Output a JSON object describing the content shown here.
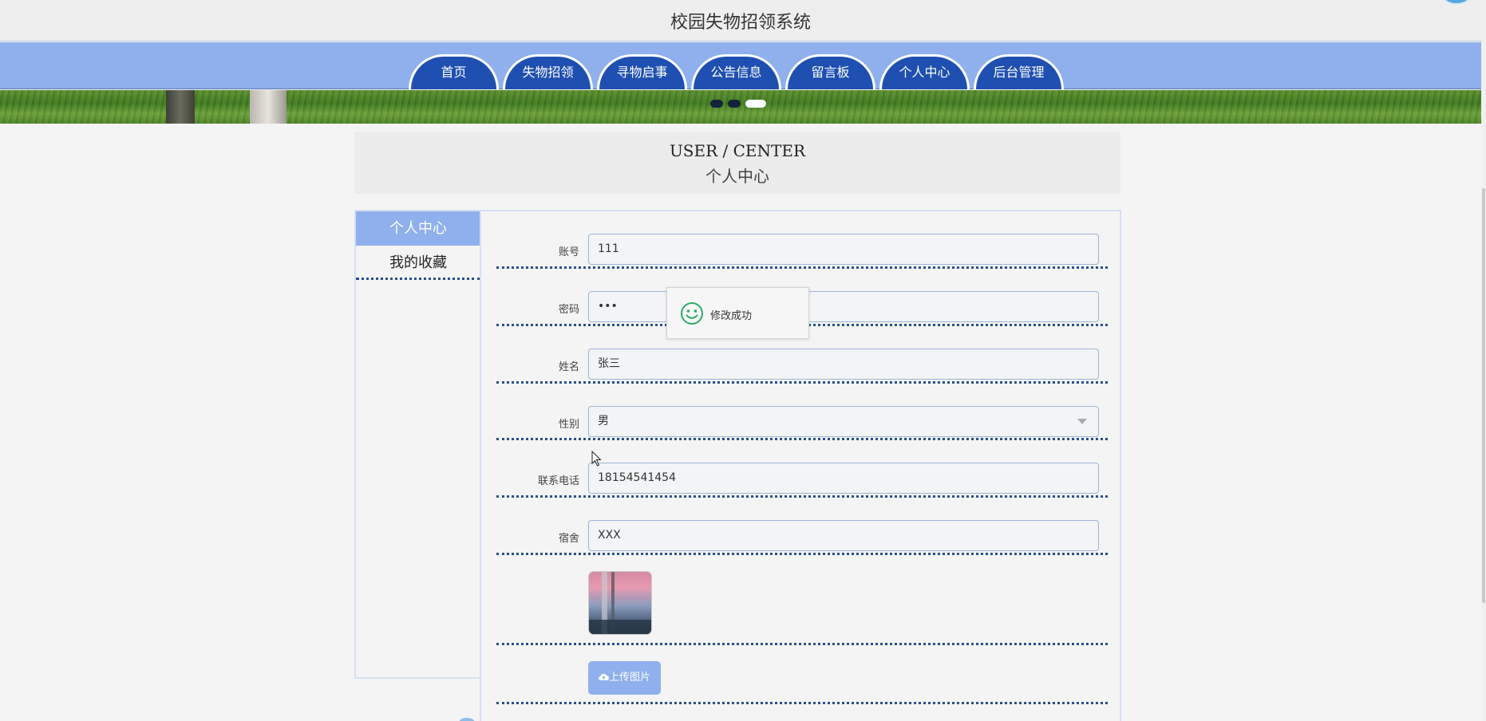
{
  "header": {
    "site_title": "校园失物招领系统"
  },
  "nav": {
    "tabs": [
      {
        "label": "首页"
      },
      {
        "label": "失物招领"
      },
      {
        "label": "寻物启事"
      },
      {
        "label": "公告信息"
      },
      {
        "label": "留言板"
      },
      {
        "label": "个人中心"
      },
      {
        "label": "后台管理"
      }
    ]
  },
  "banner": {
    "slides": 3,
    "active_slide": 3
  },
  "section": {
    "title_en": "USER / CENTER",
    "title_zh": "个人中心"
  },
  "sidebar": {
    "items": [
      {
        "label": "个人中心",
        "active": true
      },
      {
        "label": "我的收藏",
        "active": false
      }
    ]
  },
  "form": {
    "account": {
      "label": "账号",
      "value": "111"
    },
    "password": {
      "label": "密码",
      "value": "•••"
    },
    "name": {
      "label": "姓名",
      "value": "张三"
    },
    "gender": {
      "label": "性别",
      "value": "男"
    },
    "phone": {
      "label": "联系电话",
      "value": "18154541454"
    },
    "dorm": {
      "label": "宿舍",
      "value": "XXX"
    },
    "upload_label": "上传图片"
  },
  "toast": {
    "message": "修改成功",
    "icon": "smile-icon"
  },
  "colors": {
    "nav_band": "#8fb0ec",
    "nav_tab": "#1f4fb0",
    "accent": "#8fb0ec",
    "divider": "#2a4f8d",
    "toast_icon": "#2eaa6a"
  }
}
